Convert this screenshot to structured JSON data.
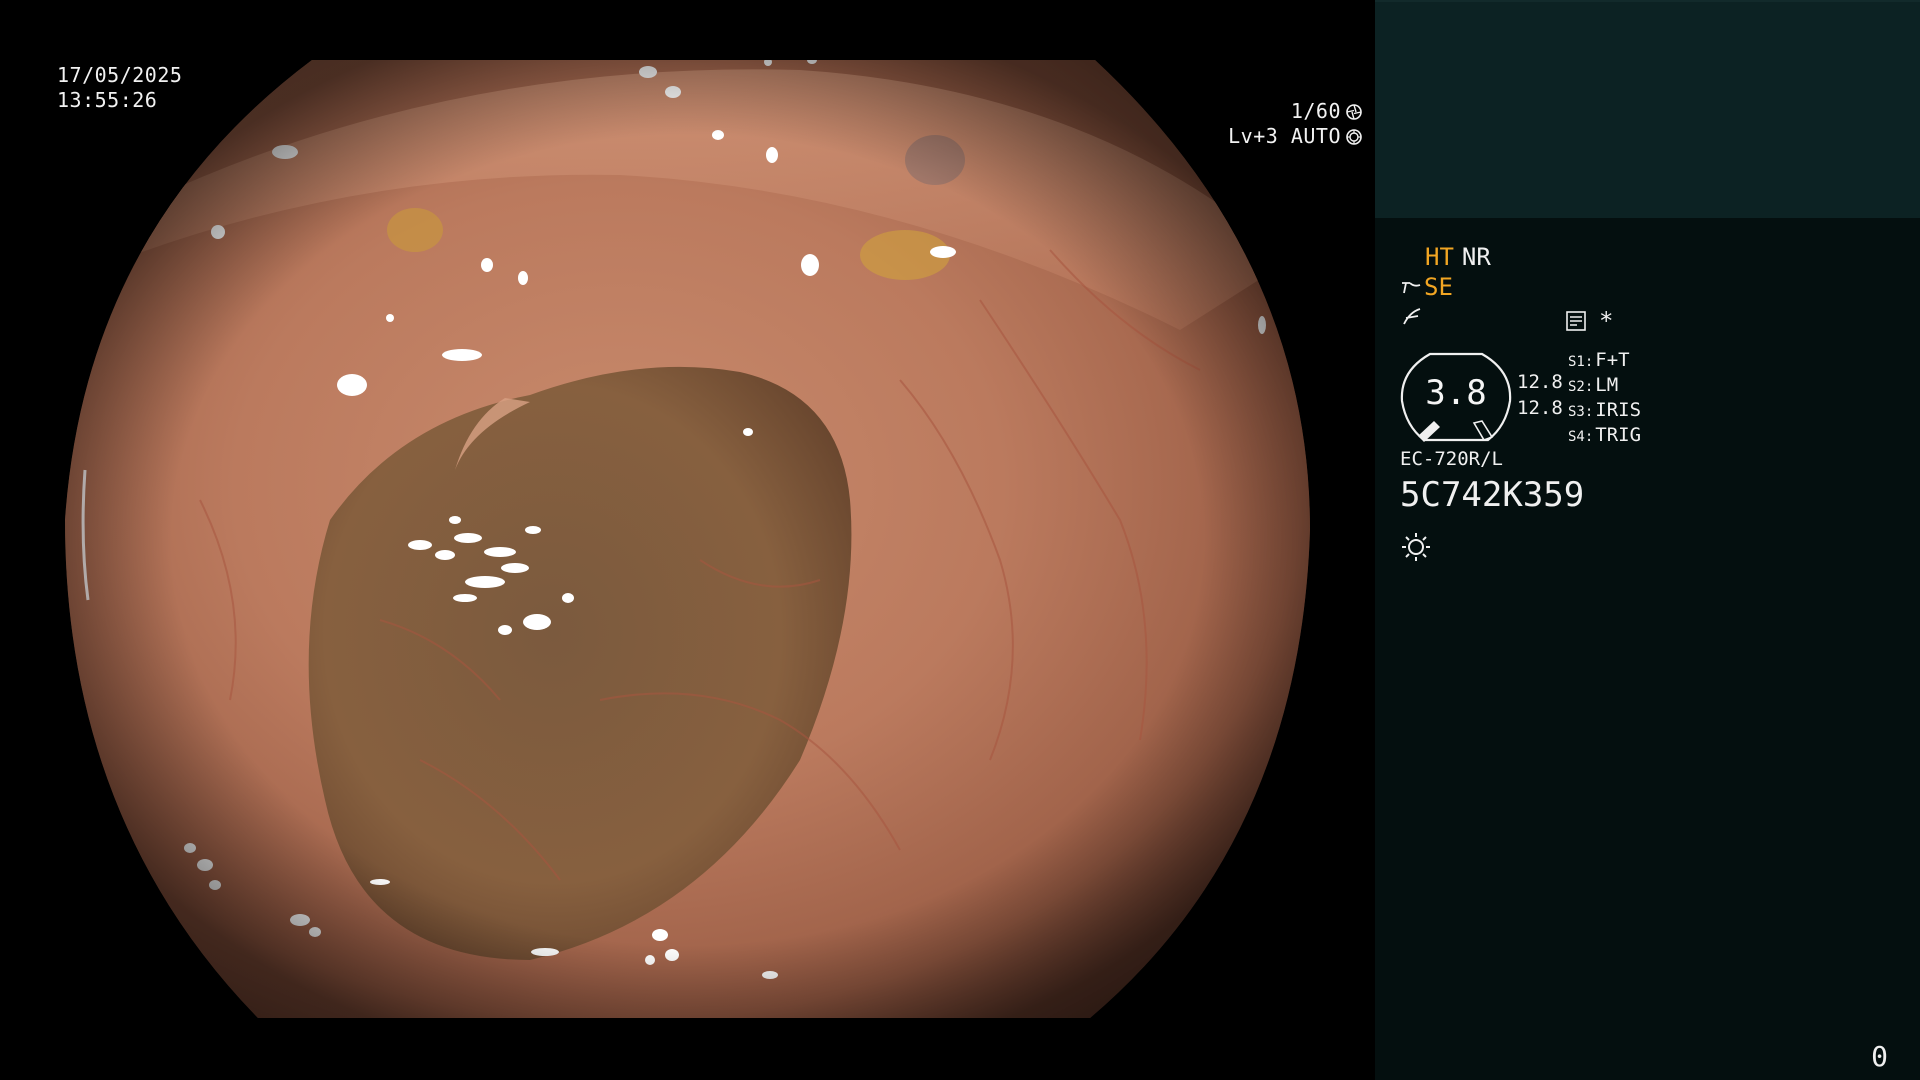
{
  "overlay": {
    "date": "17/05/2025",
    "time": "13:55:26",
    "shutter": "1/60",
    "level_mode": "Lv+3 AUTO",
    "shutter_icon": "aperture-icon",
    "auto_icon": "iris-ring-icon"
  },
  "panel": {
    "modes": {
      "ht": "HT",
      "nr": "NR",
      "se": "SE",
      "enhance_icon": "structure-enhance-icon",
      "contrast_icon": "contrast-curve-icon",
      "memo_icon": "memo-card-icon",
      "asterisk": "*"
    },
    "dial": {
      "value": "3.8"
    },
    "gain_top": "12.8",
    "gain_bottom": "12.8",
    "switches": [
      {
        "key": "S1:",
        "value": "F+T"
      },
      {
        "key": "S2:",
        "value": "LM"
      },
      {
        "key": "S3:",
        "value": "IRIS"
      },
      {
        "key": "S4:",
        "value": "TRIG"
      }
    ],
    "scope_model": "EC-720R/L",
    "scope_serial": "5C742K359",
    "light_icon": "light-source-sun-icon",
    "counter": "0"
  },
  "colors": {
    "accent": "#f2a623",
    "panel_bg": "#040f0f",
    "panel_top_bg": "#0c2223",
    "osd_text": "#f2f2f2"
  }
}
